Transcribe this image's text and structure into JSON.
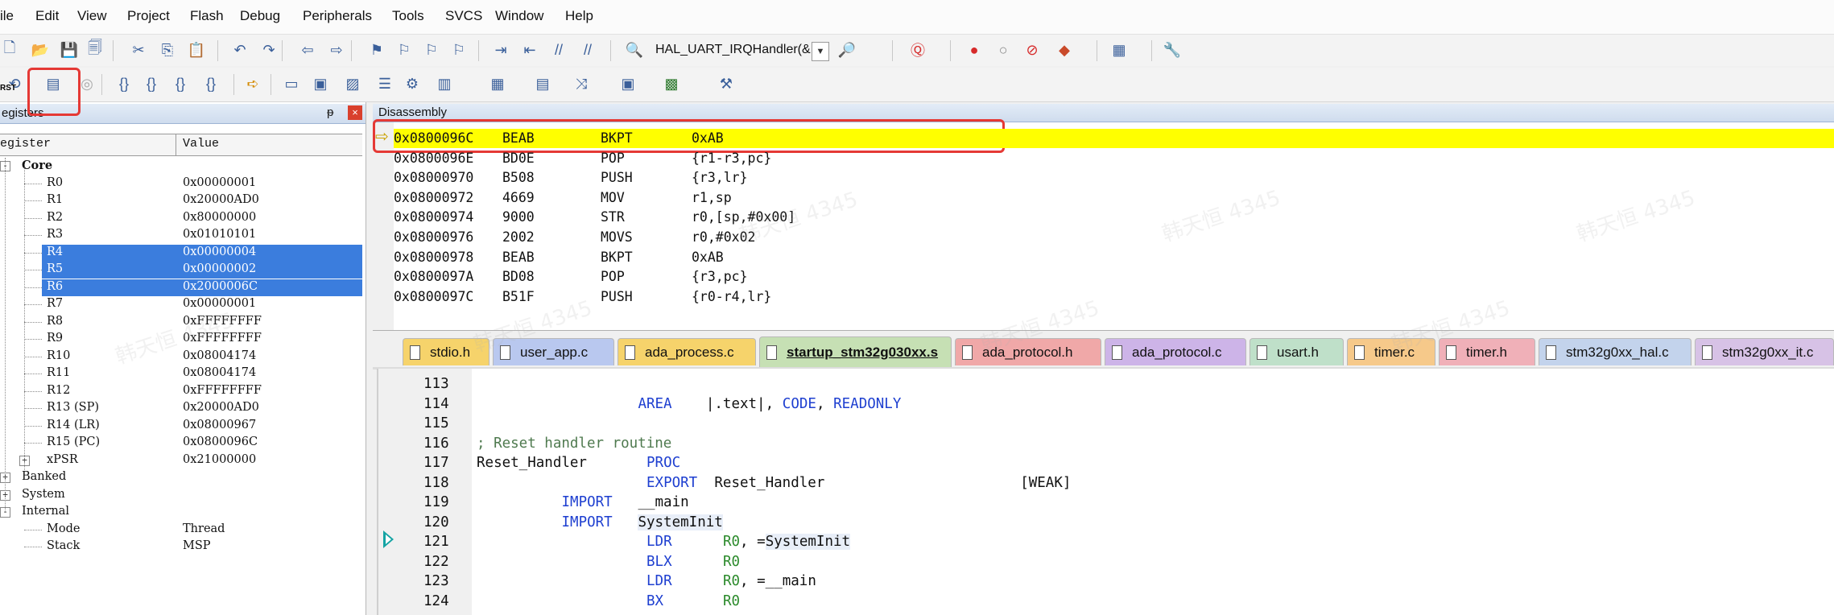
{
  "menu": [
    "ile",
    "Edit",
    "View",
    "Project",
    "Flash",
    "Debug",
    "Peripherals",
    "Tools",
    "SVCS",
    "Window",
    "Help"
  ],
  "toolbar": {
    "function_combo": "HAL_UART_IRQHandler(&",
    "rst_label": "RST",
    "icons": [
      "new-file-icon",
      "open-folder-icon",
      "save-icon",
      "save-all-icon",
      "cut-icon",
      "copy-icon",
      "paste-icon",
      "undo-icon",
      "redo-icon",
      "nav-back-icon",
      "nav-forward-icon",
      "bookmark-icon",
      "bookmark-prev-icon",
      "bookmark-next-icon",
      "bookmark-clear-icon",
      "indent-icon",
      "unindent-icon",
      "comment-icon",
      "uncomment-icon",
      "find-in-files-icon",
      "find-icon",
      "debug-session-icon",
      "breakpoint-insert-icon",
      "breakpoint-disable-icon",
      "breakpoint-kill-icon",
      "breakpoint-window-icon",
      "window-layout-icon",
      "configure-icon"
    ]
  },
  "registers": {
    "title": "egisters",
    "col_register": "egister",
    "col_value": "Value",
    "rows": [
      {
        "name": "Core",
        "value": "",
        "bold": true,
        "indent": 1,
        "expander": "-"
      },
      {
        "name": "R0",
        "value": "0x00000001",
        "indent": 2
      },
      {
        "name": "R1",
        "value": "0x20000AD0",
        "indent": 2
      },
      {
        "name": "R2",
        "value": "0x80000000",
        "indent": 2
      },
      {
        "name": "R3",
        "value": "0x01010101",
        "indent": 2
      },
      {
        "name": "R4",
        "value": "0x00000004",
        "indent": 2,
        "selected": true
      },
      {
        "name": "R5",
        "value": "0x00000002",
        "indent": 2,
        "selected": true
      },
      {
        "name": "R6",
        "value": "0x2000006C",
        "indent": 2,
        "selected": true
      },
      {
        "name": "R7",
        "value": "0x00000001",
        "indent": 2
      },
      {
        "name": "R8",
        "value": "0xFFFFFFFF",
        "indent": 2
      },
      {
        "name": "R9",
        "value": "0xFFFFFFFF",
        "indent": 2
      },
      {
        "name": "R10",
        "value": "0x08004174",
        "indent": 2
      },
      {
        "name": "R11",
        "value": "0x08004174",
        "indent": 2
      },
      {
        "name": "R12",
        "value": "0xFFFFFFFF",
        "indent": 2
      },
      {
        "name": "R13 (SP)",
        "value": "0x20000AD0",
        "indent": 2
      },
      {
        "name": "R14 (LR)",
        "value": "0x08000967",
        "indent": 2
      },
      {
        "name": "R15 (PC)",
        "value": "0x0800096C",
        "indent": 2
      },
      {
        "name": "xPSR",
        "value": "0x21000000",
        "indent": 2,
        "expander": "+"
      },
      {
        "name": "Banked",
        "value": "",
        "indent": 1,
        "expander": "+"
      },
      {
        "name": "System",
        "value": "",
        "indent": 1,
        "expander": "+"
      },
      {
        "name": "Internal",
        "value": "",
        "indent": 1,
        "expander": "-"
      },
      {
        "name": "Mode",
        "value": "Thread",
        "indent": 2
      },
      {
        "name": "Stack",
        "value": "MSP",
        "indent": 2
      }
    ]
  },
  "disassembly": {
    "title": "Disassembly",
    "rows": [
      {
        "addr": "0x0800096C",
        "code": "BEAB",
        "mnem": "BKPT",
        "ops": "0xAB",
        "current": true
      },
      {
        "addr": "0x0800096E",
        "code": "BD0E",
        "mnem": "POP",
        "ops": "{r1-r3,pc}"
      },
      {
        "addr": "0x08000970",
        "code": "B508",
        "mnem": "PUSH",
        "ops": "{r3,lr}"
      },
      {
        "addr": "0x08000972",
        "code": "4669",
        "mnem": "MOV",
        "ops": "r1,sp"
      },
      {
        "addr": "0x08000974",
        "code": "9000",
        "mnem": "STR",
        "ops": "r0,[sp,#0x00]"
      },
      {
        "addr": "0x08000976",
        "code": "2002",
        "mnem": "MOVS",
        "ops": "r0,#0x02"
      },
      {
        "addr": "0x08000978",
        "code": "BEAB",
        "mnem": "BKPT",
        "ops": "0xAB"
      },
      {
        "addr": "0x0800097A",
        "code": "BD08",
        "mnem": "POP",
        "ops": "{r3,pc}"
      },
      {
        "addr": "0x0800097C",
        "code": "B51F",
        "mnem": "PUSH",
        "ops": "{r0-r4,lr}"
      }
    ]
  },
  "tabs": [
    {
      "label": "stdio.h",
      "color": "#f6d36b"
    },
    {
      "label": "user_app.c",
      "color": "#b9c8ef"
    },
    {
      "label": "ada_process.c",
      "color": "#f6d36b"
    },
    {
      "label": "startup_stm32g030xx.s",
      "color": "#c6e0b4",
      "active": true
    },
    {
      "label": "ada_protocol.h",
      "color": "#f0a8a8"
    },
    {
      "label": "ada_protocol.c",
      "color": "#cdb4e8"
    },
    {
      "label": "usart.h",
      "color": "#bfe0c9"
    },
    {
      "label": "timer.c",
      "color": "#f6c98a"
    },
    {
      "label": "timer.h",
      "color": "#f0b0b8"
    },
    {
      "label": "stm32g0xx_hal.c",
      "color": "#c3d3ec"
    },
    {
      "label": "stm32g0xx_it.c",
      "color": "#d7c2e6"
    }
  ],
  "editor": {
    "lines": [
      {
        "n": "113",
        "parts": []
      },
      {
        "n": "114",
        "parts": [
          {
            "t": "AREA",
            "cls": "kw",
            "col": 19
          },
          {
            "t": "|.text|, ",
            "cls": "",
            "col": 27
          },
          {
            "t": "CODE",
            "cls": "kw",
            "col": 36
          },
          {
            "t": ", ",
            "cls": "",
            "col": 40
          },
          {
            "t": "READONLY",
            "cls": "kw",
            "col": 42
          }
        ]
      },
      {
        "n": "115",
        "parts": []
      },
      {
        "n": "116",
        "parts": [
          {
            "t": "; Reset handler routine",
            "cls": "cmt",
            "col": 0
          }
        ]
      },
      {
        "n": "117",
        "parts": [
          {
            "t": "Reset_Handler",
            "cls": "",
            "col": 0
          },
          {
            "t": "PROC",
            "cls": "kw",
            "col": 20
          }
        ]
      },
      {
        "n": "118",
        "parts": [
          {
            "t": "EXPORT",
            "cls": "kw",
            "col": 20
          },
          {
            "t": "Reset_Handler",
            "cls": "",
            "col": 28
          },
          {
            "t": "[WEAK]",
            "cls": "",
            "col": 64
          }
        ]
      },
      {
        "n": "119",
        "parts": [
          {
            "t": "IMPORT",
            "cls": "kw",
            "col": 10
          },
          {
            "t": "__main",
            "cls": "",
            "col": 19
          }
        ]
      },
      {
        "n": "120",
        "parts": [
          {
            "t": "IMPORT",
            "cls": "kw",
            "col": 10
          },
          {
            "t": "SystemInit",
            "cls": "hl-word",
            "col": 19
          }
        ]
      },
      {
        "n": "121",
        "parts": [
          {
            "t": "LDR",
            "cls": "kw",
            "col": 20
          },
          {
            "t": "R0",
            "cls": "reg",
            "col": 29
          },
          {
            "t": ", =",
            "cls": "",
            "col": 31
          },
          {
            "t": "SystemInit",
            "cls": "hl-word",
            "col": 34
          }
        ]
      },
      {
        "n": "122",
        "parts": [
          {
            "t": "BLX",
            "cls": "kw",
            "col": 20
          },
          {
            "t": "R0",
            "cls": "reg",
            "col": 29
          }
        ]
      },
      {
        "n": "123",
        "parts": [
          {
            "t": "LDR",
            "cls": "kw",
            "col": 20
          },
          {
            "t": "R0",
            "cls": "reg",
            "col": 29
          },
          {
            "t": ", =__main",
            "cls": "",
            "col": 31
          }
        ]
      },
      {
        "n": "124",
        "parts": [
          {
            "t": "BX",
            "cls": "kw",
            "col": 20
          },
          {
            "t": "R0",
            "cls": "reg",
            "col": 29
          }
        ]
      }
    ]
  },
  "watermark": "韩天恒 4345"
}
